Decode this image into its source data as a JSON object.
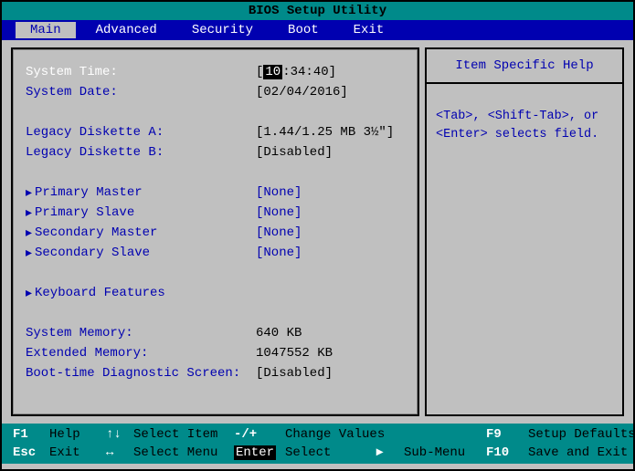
{
  "title": "BIOS Setup Utility",
  "menu": {
    "main": "Main",
    "advanced": "Advanced",
    "security": "Security",
    "boot": "Boot",
    "exit": "Exit"
  },
  "fields": {
    "system_time_label": "System Time:",
    "system_date_label": "System Date:",
    "legacy_a_label": "Legacy Diskette A:",
    "legacy_b_label": "Legacy Diskette B:",
    "primary_master_label": "Primary Master",
    "primary_slave_label": "Primary Slave",
    "secondary_master_label": "Secondary Master",
    "secondary_slave_label": "Secondary Slave",
    "keyboard_features_label": "Keyboard Features",
    "system_memory_label": "System Memory:",
    "extended_memory_label": "Extended Memory:",
    "boot_diag_label": "Boot-time Diagnostic Screen:"
  },
  "values": {
    "time_pre": "[",
    "time_sel": "10",
    "time_post": ":34:40]",
    "date": "[02/04/2016]",
    "legacy_a": "[1.44/1.25 MB  3½\"]",
    "legacy_b": "[Disabled]",
    "primary_master": "[None]",
    "primary_slave": "[None]",
    "secondary_master": "[None]",
    "secondary_slave": "[None]",
    "system_memory": "640 KB",
    "extended_memory": "1047552 KB",
    "boot_diag": "[Disabled]"
  },
  "help": {
    "title": "Item Specific Help",
    "body": "<Tab>, <Shift-Tab>, or <Enter> selects field."
  },
  "footer": {
    "f1": "F1",
    "help": "Help",
    "updown": "↑↓",
    "select_item": "Select Item",
    "pm": "-/+",
    "change_values": "Change Values",
    "f9": "F9",
    "setup_defaults": "Setup Defaults",
    "esc": "Esc",
    "exit": "Exit",
    "lr": "↔",
    "select_menu": "Select Menu",
    "enter": "Enter",
    "select": "Select",
    "tri": "▸",
    "submenu": "Sub-Menu",
    "f10": "F10",
    "save_exit": "Save and Exit"
  },
  "glyphs": {
    "tri": "▸"
  }
}
